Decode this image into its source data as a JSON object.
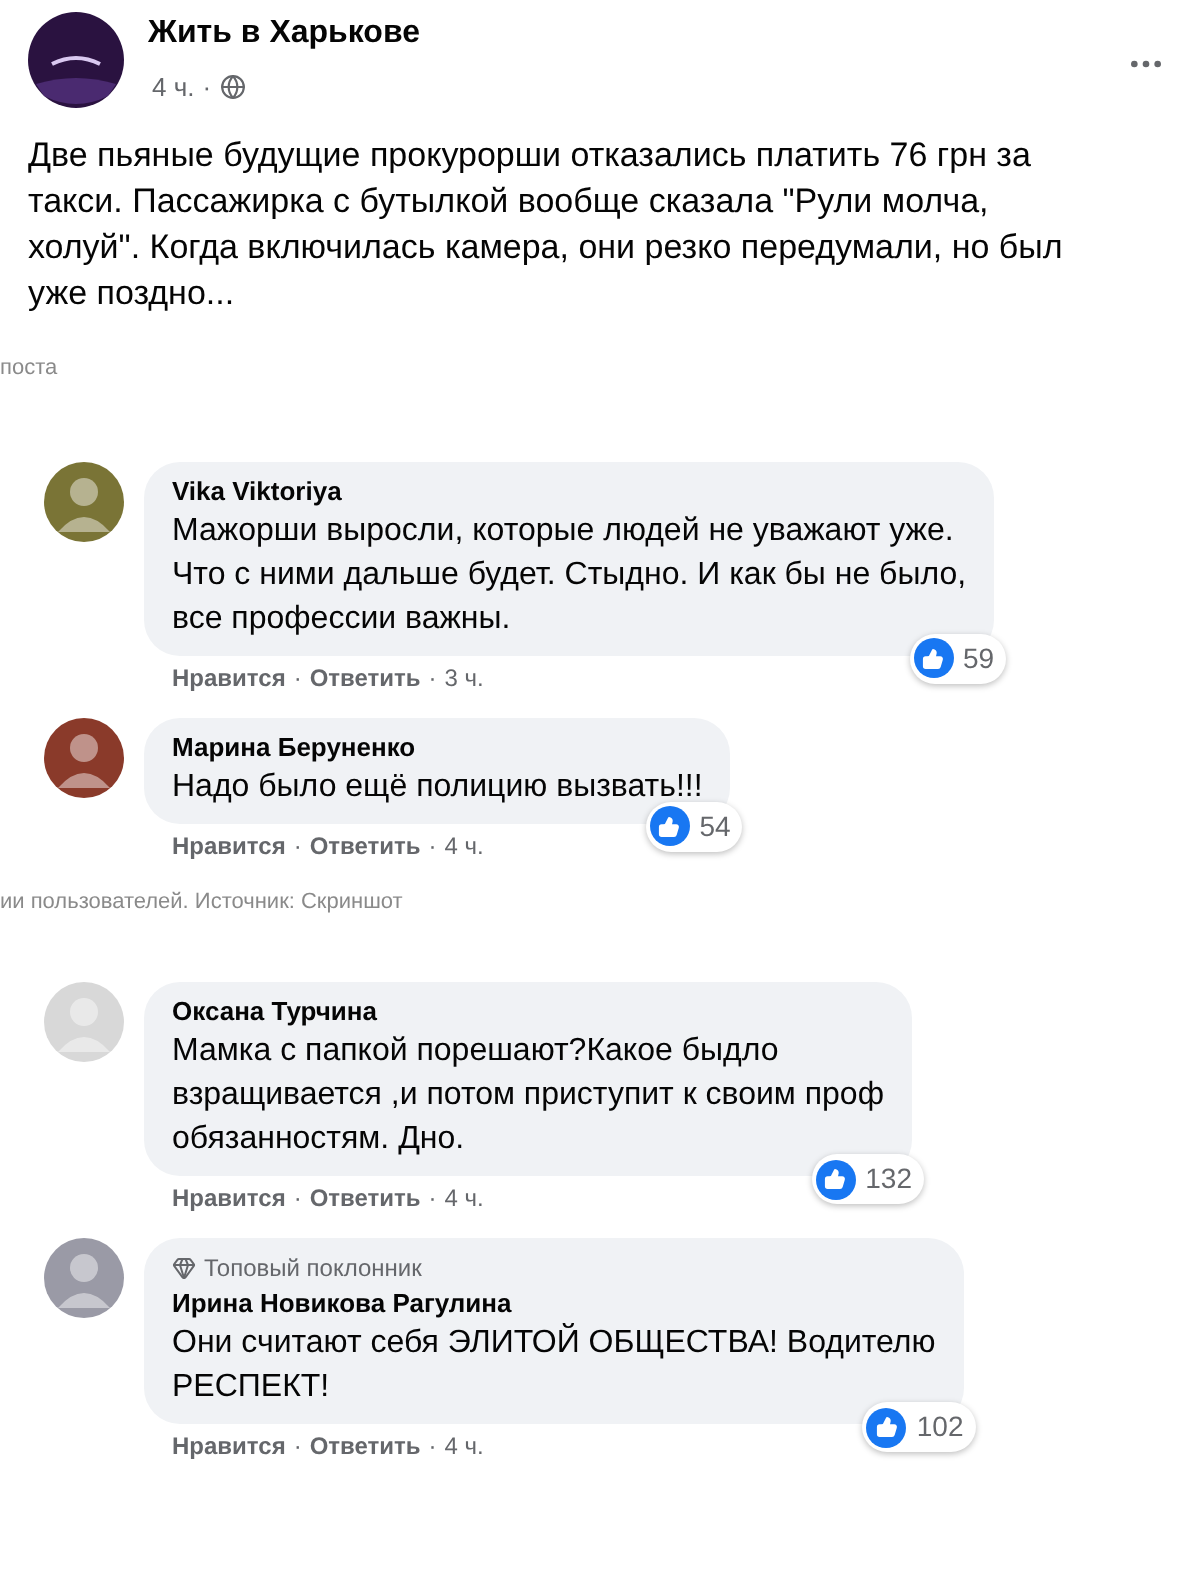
{
  "post": {
    "page_name": "Жить в Харькове",
    "time": "4 ч.",
    "separator": "·",
    "text_lines": [
      "Две пьяные будущие прокурорши отказались платить 76 грн за",
      "такси. Пассажирка с бутылкой вообще сказала \"Рули молча,",
      "холуй\". Когда включилась камера, они резко передумали, но был",
      "уже поздно..."
    ]
  },
  "captions": [
    "поста",
    "ии пользователей. Источник: Скриншот"
  ],
  "comment_groups": [
    {
      "comments": [
        {
          "author": "Vika Viktoriya",
          "lines": [
            "Мажорши выросли, которые людей не уважают уже.",
            "Что с ними дальше будет. Стыдно. И как бы не было,",
            "все профессии важны."
          ],
          "likes": "59",
          "like": "Нравится",
          "separator": "·",
          "reply": "Ответить",
          "time": "3 ч."
        },
        {
          "author": "Марина Беруненко",
          "lines": [
            "Надо было ещё полицию вызвать!!!"
          ],
          "likes": "54",
          "like": "Нравится",
          "separator": "·",
          "reply": "Ответить",
          "time": "4 ч."
        }
      ]
    },
    {
      "comments": [
        {
          "author": "Оксана Турчина",
          "lines": [
            "Мамка с папкой порешают?Какое быдло",
            "взращивается ,и потом приступит к своим проф",
            "обязанностям. Дно."
          ],
          "likes": "132",
          "like": "Нравится",
          "separator": "·",
          "reply": "Ответить",
          "time": "4 ч."
        },
        {
          "author": "Ирина Новикова Рагулина",
          "badge": "Топовый поклонник",
          "lines": [
            "Они считают себя ЭЛИТОЙ ОБЩЕСТВА! Водителю",
            "РЕСПЕКТ!"
          ],
          "likes": "102",
          "like": "Нравится",
          "separator": "·",
          "reply": "Ответить",
          "time": "4 ч."
        }
      ]
    }
  ]
}
